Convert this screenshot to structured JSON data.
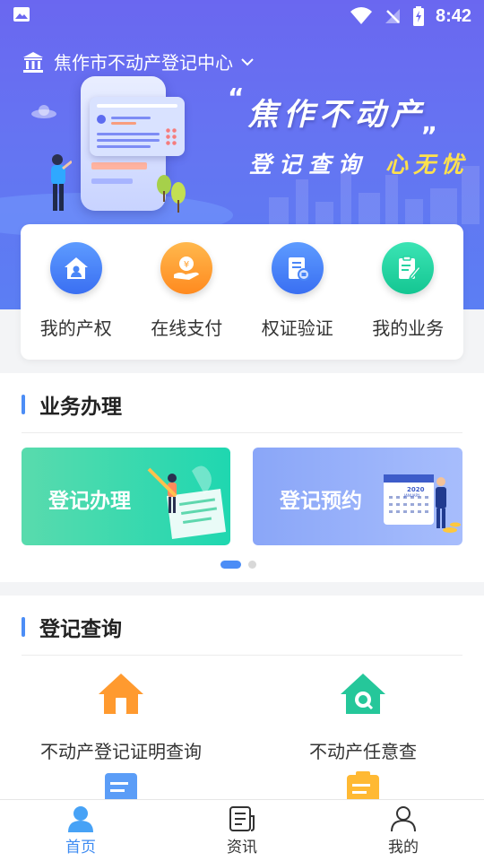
{
  "status_bar": {
    "time": "8:42",
    "icons": [
      "image-icon",
      "wifi-icon",
      "no-signal-icon",
      "battery-charging-icon"
    ]
  },
  "header": {
    "location": "焦作市不动产登记中心",
    "location_icon": "government-building-icon",
    "dropdown_icon": "chevron-down-icon"
  },
  "hero": {
    "quote_open": "“",
    "quote_close": "„",
    "slogan_line1": "焦作不动产",
    "slogan_line2_a": "登记查询",
    "slogan_line2_b": "心无忧",
    "highlight_color": "#ffe14d"
  },
  "quick_actions": [
    {
      "label": "我的产权",
      "icon": "house-icon",
      "color": "#4a86f7"
    },
    {
      "label": "在线支付",
      "icon": "payment-icon",
      "color": "#ff9e2c"
    },
    {
      "label": "权证验证",
      "icon": "certificate-icon",
      "color": "#4a86f7"
    },
    {
      "label": "我的业务",
      "icon": "edit-document-icon",
      "color": "#25d3a1"
    }
  ],
  "business": {
    "title": "业务办理",
    "banners": [
      {
        "label": "登记办理"
      },
      {
        "label": "登记预约",
        "calendar_year": "2020",
        "calendar_month": "JANUARY"
      }
    ],
    "pager": {
      "current": 1,
      "total": 2
    }
  },
  "query": {
    "title": "登记查询",
    "items": [
      {
        "label": "不动产登记证明查询",
        "icon": "home-icon",
        "color": "#ff9a2f"
      },
      {
        "label": "不动产任意查",
        "icon": "home-search-icon",
        "color": "#25c79a"
      },
      {
        "label": "",
        "icon": "document-icon",
        "color": "#5b9df7"
      },
      {
        "label": "",
        "icon": "clipboard-icon",
        "color": "#ffb933"
      }
    ]
  },
  "bottom_nav": [
    {
      "label": "首页",
      "icon": "person-filled-icon",
      "active": true
    },
    {
      "label": "资讯",
      "icon": "news-icon",
      "active": false
    },
    {
      "label": "我的",
      "icon": "person-outline-icon",
      "active": false
    }
  ],
  "colors": {
    "accent": "#4c8df6",
    "hero_start": "#6a67f0",
    "hero_end": "#5b7ef3"
  }
}
